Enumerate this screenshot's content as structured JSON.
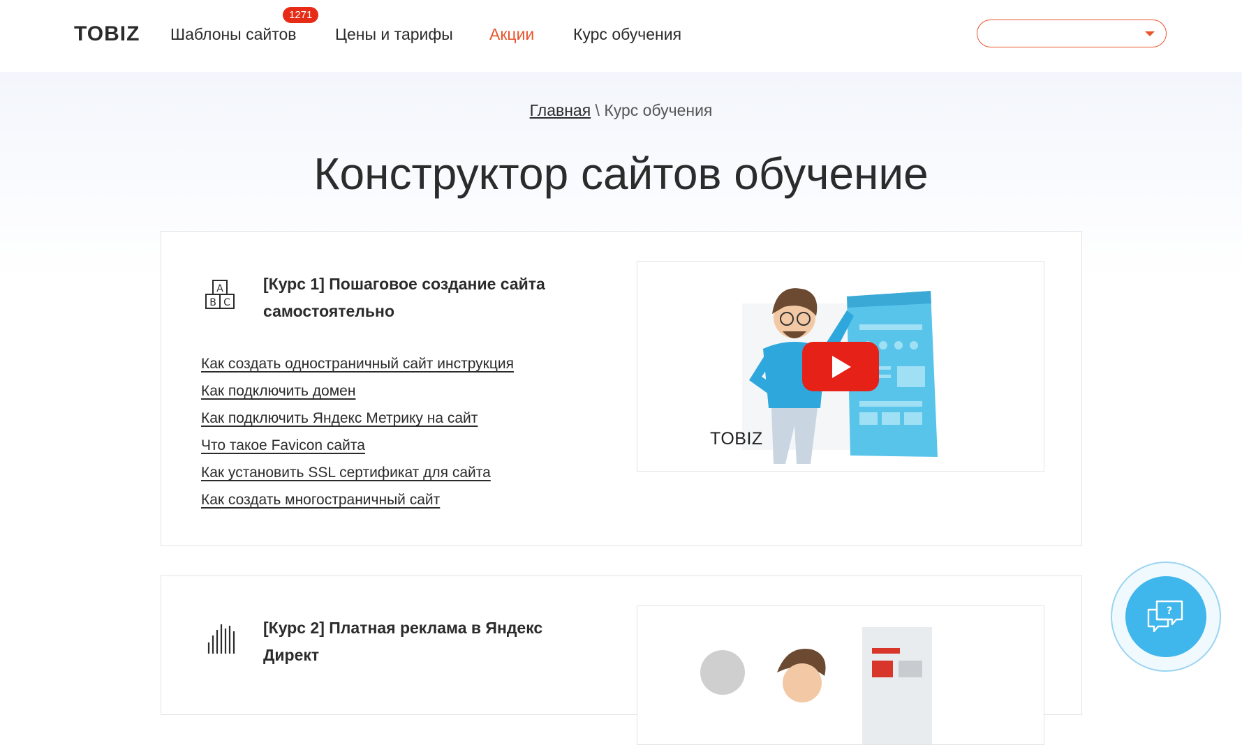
{
  "header": {
    "logo": "TOBIZ",
    "nav": [
      {
        "label": "Шаблоны сайтов",
        "badge": "1271"
      },
      {
        "label": "Цены и тарифы"
      },
      {
        "label": "Акции"
      },
      {
        "label": "Курс обучения"
      }
    ],
    "language_select": {
      "value": ""
    }
  },
  "breadcrumb": {
    "home": "Главная",
    "separator": "\\",
    "current": "Курс обучения"
  },
  "page_title": "Конструктор сайтов обучение",
  "courses": [
    {
      "title": "[Курс 1] Пошаговое создание сайта самостоятельно",
      "icon": "abc-blocks-icon",
      "lessons": [
        "Как создать одностраничный сайт инструкция",
        "Как подключить домен",
        "Как подключить Яндекс Метрику на сайт",
        "Что такое Favicon сайта",
        "Как установить SSL сертификат для сайта",
        "Как создать многостраничный сайт"
      ],
      "video": {
        "brand": "TOBIZ",
        "play_icon": "youtube-play-icon"
      }
    },
    {
      "title": "[Курс 2] Платная реклама в Яндекс Директ",
      "icon": "bar-lines-icon",
      "lessons": [],
      "video": {
        "brand": ""
      }
    }
  ],
  "chat": {
    "icon": "chat-question-icon"
  },
  "colors": {
    "accent": "#e8542b",
    "badge": "#e62c17",
    "chat": "#3fb6ec",
    "play": "#e62117"
  }
}
